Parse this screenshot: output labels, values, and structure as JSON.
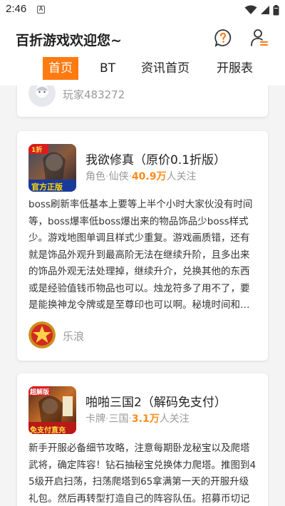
{
  "status": {
    "time": "2:46",
    "app_icon_letter": "A"
  },
  "header": {
    "title": "百折游戏欢迎您~"
  },
  "tabs": [
    "首页",
    "BT",
    "资讯首页",
    "开服表"
  ],
  "feed": {
    "partial_author": "玩家483272",
    "cards": [
      {
        "name": "我欲修真（原价0.1折版）",
        "genre": "角色",
        "style": "仙侠",
        "followers": "40.9万",
        "followers_suffix": "人关注",
        "thumb_badge_top": "1折",
        "thumb_badge_bottom": "官方正版",
        "description": "boss刷新率低基本上要等上半个小时大家伙没有时间等，boss爆率低boss爆出来的物品饰品少boss样式少。游戏地图单调且样式少重复。游戏画质错，还有就是饰品外观升到最高阶无法在继续升阶，且多出来的饰品外观无法处理掉，继续升介，兑换其他的东西或是经验值钱币物品也可以。烛龙符多了用不了，要是能换神龙令牌或是至尊印也可以啊。秘境时间和养成的东西太多了",
        "author": "乐浪"
      },
      {
        "name": "啪啪三国2（解码免支付）",
        "genre": "卡牌",
        "style": "三国",
        "followers": "3.1万",
        "followers_suffix": "人关注",
        "thumb_badge_top": "超解版",
        "thumb_badge_bottom": "免支付直充",
        "description": "新手开服必备细节攻略，注意每期卧龙秘宝以及爬塔武将，确定阵容！钻石抽秘宝兑换体力爬塔。推图到45级开启扫荡，扫荡爬塔到65拿满第一天的开服升级礼包。然后再转型打造自己的阵容队伍。招募币切记"
      }
    ]
  },
  "colors": {
    "accent": "#ff7a10",
    "follower_number": "#ff8a1a",
    "meta_gray": "#999999"
  }
}
